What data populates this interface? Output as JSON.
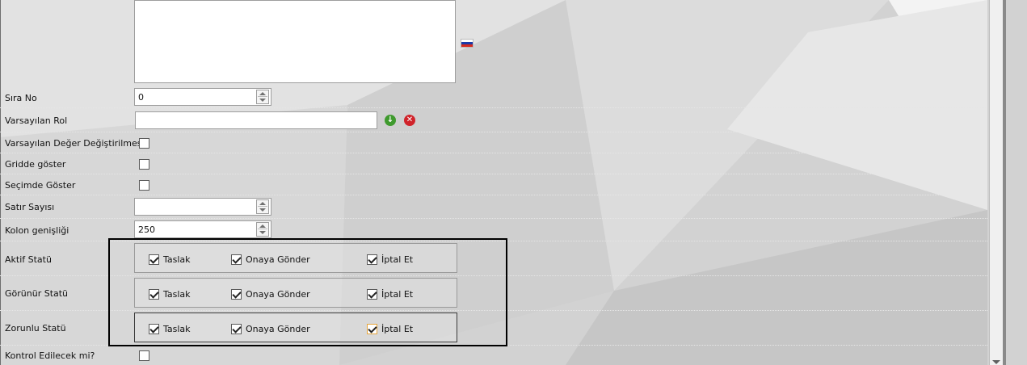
{
  "form": {
    "flag_icon": "russian-flag-icon",
    "rows": {
      "sira_no": {
        "label": "Sıra No",
        "value": "0"
      },
      "varsayilan_rol": {
        "label": "Varsayılan Rol",
        "value": "",
        "add_icon": "add-circle-icon",
        "remove_icon": "remove-circle-icon"
      },
      "varsayilan_deger": {
        "label": "Varsayılan Değer Değiştirilmesin",
        "checked": false
      },
      "gridde_goster": {
        "label": "Gridde göster",
        "checked": false
      },
      "secimde_goster": {
        "label": "Seçimde Göster",
        "checked": false
      },
      "satir_sayisi": {
        "label": "Satır Sayısı",
        "value": ""
      },
      "kolon_genisligi": {
        "label": "Kolon genişliği",
        "value": "250"
      },
      "kontrol": {
        "label": "Kontrol Edilecek mi?",
        "checked": false
      }
    },
    "status_groups": [
      {
        "label": "Aktif Statü",
        "options": [
          {
            "label": "Taslak",
            "checked": true
          },
          {
            "label": "Onaya Gönder",
            "checked": true
          },
          {
            "label": "İptal Et",
            "checked": true
          }
        ]
      },
      {
        "label": "Görünür Statü",
        "options": [
          {
            "label": "Taslak",
            "checked": true
          },
          {
            "label": "Onaya Gönder",
            "checked": true
          },
          {
            "label": "İptal Et",
            "checked": true
          }
        ]
      },
      {
        "label": "Zorunlu Statü",
        "options": [
          {
            "label": "Taslak",
            "checked": true
          },
          {
            "label": "Onaya Gönder",
            "checked": true
          },
          {
            "label": "İptal Et",
            "checked": true
          }
        ]
      }
    ]
  },
  "colors": {
    "add": "#3f9a2e",
    "remove": "#d0232a",
    "highlight_border": "#000000"
  }
}
